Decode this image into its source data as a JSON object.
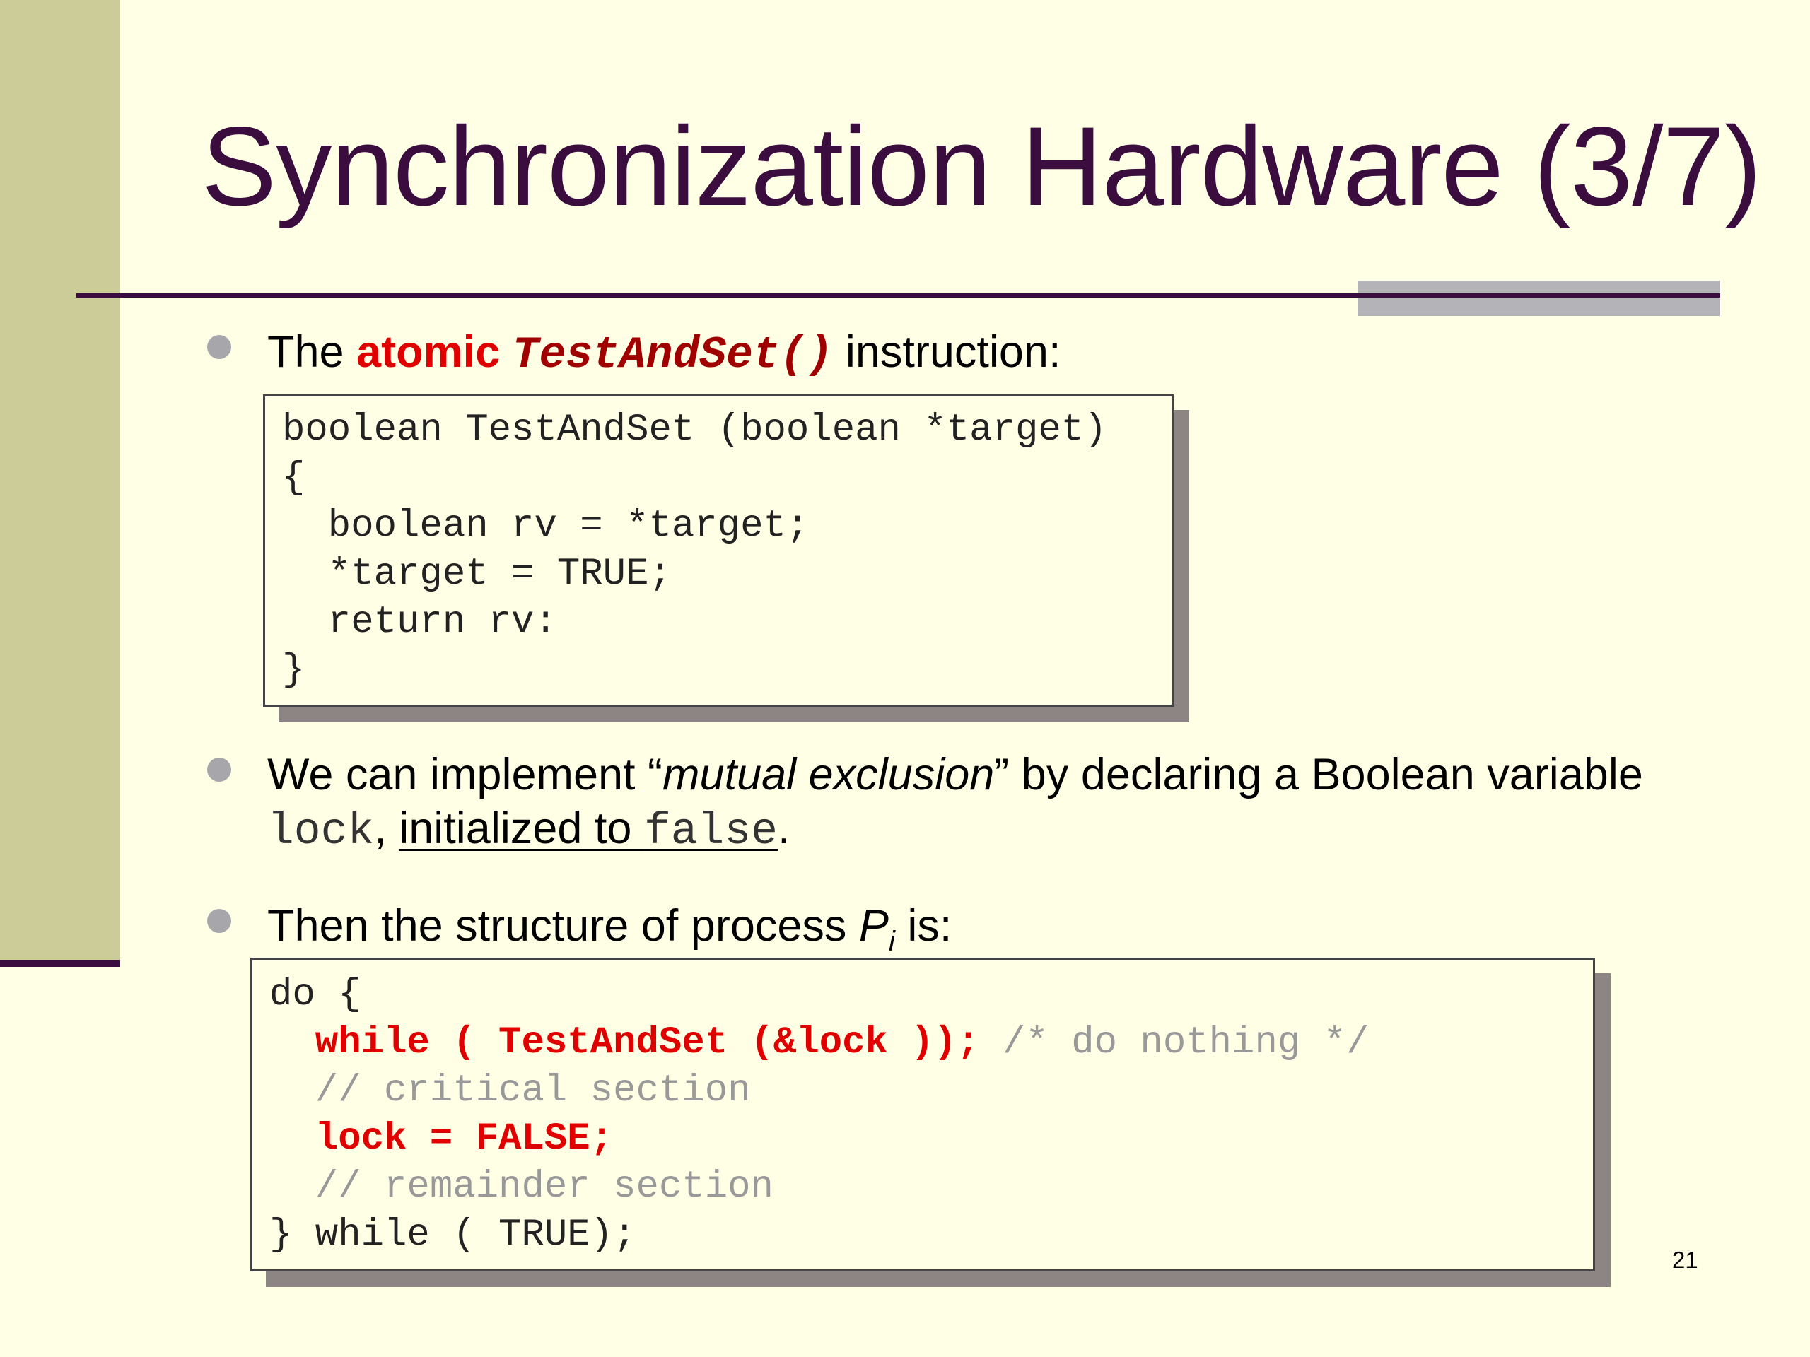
{
  "slide": {
    "title": "Synchronization Hardware (3/7)",
    "page_number": "21"
  },
  "bullet1": {
    "prefix": "The ",
    "atomic": "atomic",
    "space": " ",
    "func": "TestAndSet()",
    "suffix": " instruction:"
  },
  "code1": {
    "lines": [
      "boolean TestAndSet (boolean *target)",
      "{",
      "  boolean rv = *target;",
      "  *target = TRUE;",
      "  return rv:",
      "}"
    ]
  },
  "bullet2": {
    "text1": "We can implement “",
    "italic": "mutual exclusion",
    "text2": "” by declaring a Boolean variable",
    "lock": "lock",
    "comma": ", ",
    "underlined": "initialized to ",
    "false_word": "false",
    "period": "."
  },
  "bullet3": {
    "text": "Then the structure of process ",
    "p": "P",
    "sub": "i",
    "suffix": " is:"
  },
  "code2": {
    "line1": "do {",
    "line2_code": "  while ( TestAndSet (&lock ));",
    "line2_comment": " /* do nothing */",
    "line3": "  // critical section",
    "line4": "  lock = FALSE;",
    "line5": "  // remainder section",
    "line6": "} while ( TRUE);"
  }
}
